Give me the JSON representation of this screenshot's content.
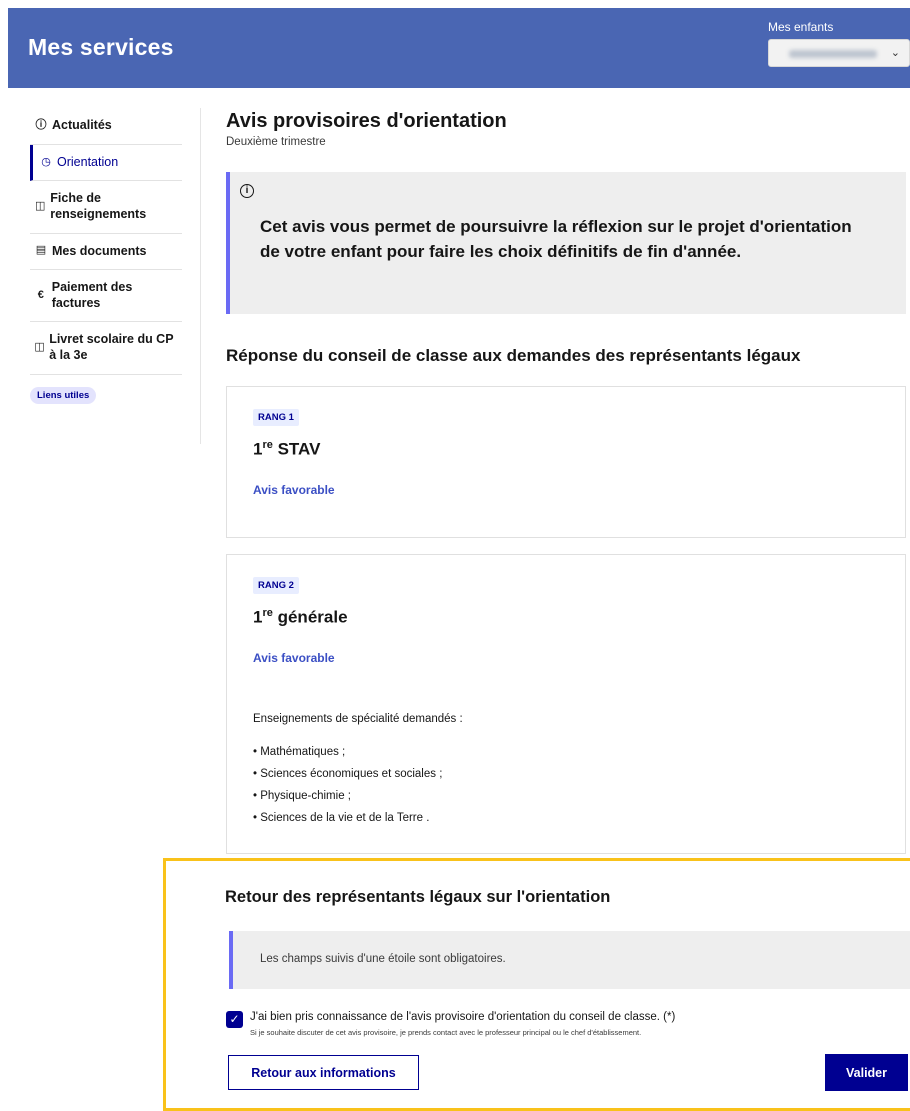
{
  "header": {
    "title": "Mes services",
    "children_label": "Mes enfants",
    "child_select": {
      "chevron_icon": "chevron-down-icon"
    },
    "color": "#4a66b3"
  },
  "sidebar": {
    "items": [
      {
        "icon": "info-circle-icon",
        "label": "Actualités"
      },
      {
        "icon": "clock-circle-icon",
        "label": "Orientation",
        "active": true
      },
      {
        "icon": "tag-icon",
        "label": "Fiche de renseignements"
      },
      {
        "icon": "documents-icon",
        "label": "Mes documents"
      },
      {
        "icon": "euro-icon",
        "label": "Paiement des factures"
      },
      {
        "icon": "book-icon",
        "label": "Livret scolaire du CP à la 3e"
      }
    ],
    "links_badge": "Liens utiles"
  },
  "main": {
    "title": "Avis provisoires d'orientation",
    "subtitle": "Deuxième trimestre",
    "callout_text": "Cet avis vous permet de poursuivre la réflexion sur le projet d'orientation de votre enfant pour faire les choix définitifs de fin d'année.",
    "section_title": "Réponse du conseil de classe aux demandes des représentants légaux",
    "cards": [
      {
        "rank": "RANG 1",
        "formation_prefix": "1",
        "formation_sup": "re",
        "formation_name": " STAV",
        "avis": "Avis favorable"
      },
      {
        "rank": "RANG 2",
        "formation_prefix": "1",
        "formation_sup": "re",
        "formation_name": " générale",
        "avis": "Avis favorable",
        "spec_title": "Enseignements de spécialité demandés :",
        "specialties": [
          "• Mathématiques ;",
          "• Sciences économiques et sociales ;",
          "• Physique-chimie ;",
          "• Sciences de la vie et de la Terre ."
        ]
      }
    ]
  },
  "retour": {
    "title": "Retour des représentants légaux sur l'orientation",
    "notice": "Les champs suivis d'une étoile sont obligatoires.",
    "checkbox_label": "J'ai bien pris connaissance de l'avis provisoire d'orientation du conseil de classe. (*)",
    "checkbox_checked": true,
    "checkbox_hint": "Si je souhaite discuter de cet avis provisoire, je prends contact avec le professeur principal ou le chef d'établissement.",
    "back_button": "Retour aux informations",
    "submit_button": "Valider",
    "highlight_color": "#f9c21a",
    "accent_color": "#000091"
  }
}
